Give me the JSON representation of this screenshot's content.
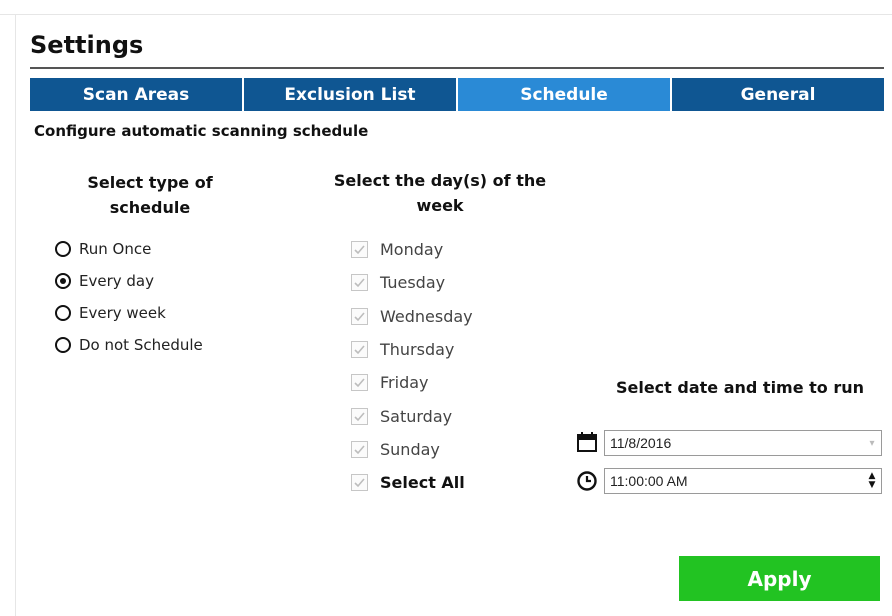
{
  "page": {
    "title": "Settings",
    "subtitle": "Configure automatic scanning schedule"
  },
  "tabs": [
    {
      "label": "Scan Areas",
      "active": false
    },
    {
      "label": "Exclusion List",
      "active": false
    },
    {
      "label": "Schedule",
      "active": true
    },
    {
      "label": "General",
      "active": false
    }
  ],
  "schedule_type": {
    "heading": "Select type of schedule",
    "options": [
      {
        "label": "Run Once",
        "checked": false
      },
      {
        "label": "Every day",
        "checked": true
      },
      {
        "label": "Every week",
        "checked": false
      },
      {
        "label": "Do not Schedule",
        "checked": false
      }
    ]
  },
  "days": {
    "heading": "Select the day(s) of the week",
    "items": [
      {
        "label": "Monday",
        "checked": true
      },
      {
        "label": "Tuesday",
        "checked": true
      },
      {
        "label": "Wednesday",
        "checked": true
      },
      {
        "label": "Thursday",
        "checked": true
      },
      {
        "label": "Friday",
        "checked": true
      },
      {
        "label": "Saturday",
        "checked": true
      },
      {
        "label": "Sunday",
        "checked": true
      }
    ],
    "select_all": {
      "label": "Select All",
      "checked": true
    }
  },
  "datetime": {
    "heading": "Select date and time to run",
    "date_value": "11/8/2016",
    "time_value": "11:00:00 AM",
    "date_icon": "calendar-icon",
    "time_icon": "clock-icon"
  },
  "apply_label": "Apply",
  "colors": {
    "tab_bg": "#0f5692",
    "tab_active_bg": "#2a8ad6",
    "apply_bg": "#22c322"
  }
}
